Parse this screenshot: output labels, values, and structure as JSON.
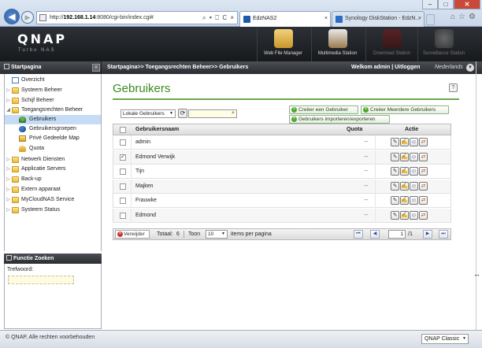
{
  "browser": {
    "address": {
      "prefix": "http://",
      "host": "192.168.1.14",
      "rest": ":8080/cgi-bin/index.cgi#"
    },
    "address_tools": "⌕ ▾ ⎕ C ×",
    "tabs": [
      {
        "label": "EdzNAS2",
        "active": true
      },
      {
        "label": "Synology DiskStation - EdzN...",
        "active": false
      }
    ],
    "window_controls": {
      "min": "–",
      "max": "□",
      "close": "✕"
    },
    "right_icons": "⌂☆⚙"
  },
  "qnap": {
    "logo": "QNAP",
    "subtitle": "Turbo NAS",
    "apps": [
      {
        "label": "Web File Manager"
      },
      {
        "label": "Multimedia Station"
      },
      {
        "label": "Download Station"
      },
      {
        "label": "Surveillance Station"
      }
    ]
  },
  "titlebar": {
    "side_title": "Startpagina",
    "collapse": "«",
    "breadcrumb": "Startpagina>> Toegangsrechten Beheer>> Gebruikers",
    "welcome": "Welkom admin | Uitloggen",
    "language": "Nederlands",
    "language_arrow": "▼"
  },
  "sidebar": {
    "items": [
      {
        "label": "Overzicht",
        "expander": ""
      },
      {
        "label": "Systeem Beheer",
        "expander": "▷"
      },
      {
        "label": "Schijf Beheer",
        "expander": "▷"
      },
      {
        "label": "Toegangsrechten Beheer",
        "expander": "◢"
      },
      {
        "label": "Gebruikers",
        "expander": ""
      },
      {
        "label": "Gebruikersgroepen",
        "expander": ""
      },
      {
        "label": "Privé Gedeelde Map",
        "expander": ""
      },
      {
        "label": "Quota",
        "expander": ""
      },
      {
        "label": "Netwerk Diensten",
        "expander": "▷"
      },
      {
        "label": "Applicatie Servers",
        "expander": "▷"
      },
      {
        "label": "Back-up",
        "expander": "▷"
      },
      {
        "label": "Extern apparaat",
        "expander": "▷"
      },
      {
        "label": "MyCloudNAS Service",
        "expander": "▷"
      },
      {
        "label": "Systeem Status",
        "expander": "▷"
      }
    ]
  },
  "func_search": {
    "title": "Functie Zoeken",
    "keyword_label": "Trefwoord:",
    "keyword_value": ""
  },
  "main": {
    "title": "Gebruikers",
    "help": "?",
    "buttons": {
      "create_user": "Creëer een Gebruiker",
      "create_multiple": "Creëer Meerdere Gebruikers",
      "import_export": "Gebruikers importeren/exporteren"
    },
    "filter_select": "Lokale Gebruikers",
    "refresh": "⟳",
    "search_value": "",
    "search_icon": "⌕",
    "columns": {
      "name": "Gebruikersnaam",
      "quota": "Quota",
      "action": "Actie"
    },
    "users": [
      {
        "name": "admin",
        "quota": "--",
        "checked": ""
      },
      {
        "name": "Edmond Verwijk",
        "quota": "--",
        "checked": "✓"
      },
      {
        "name": "Tijn",
        "quota": "--",
        "checked": ""
      },
      {
        "name": "Majken",
        "quota": "--",
        "checked": ""
      },
      {
        "name": "Frauwke",
        "quota": "--",
        "checked": ""
      },
      {
        "name": "Edmond",
        "quota": "--",
        "checked": ""
      }
    ],
    "action_icons": [
      "✎",
      "✍",
      "☺",
      "⇄"
    ],
    "pagination": {
      "delete": "Verwijder",
      "total_label": "Totaal:",
      "total_value": "6",
      "show_label": "Toon",
      "per_page_value": "10",
      "per_page_suffix": "items per pagina",
      "first": "⏮",
      "prev": "◀",
      "page_value": "1",
      "page_total": "/1",
      "next": "▶",
      "last": "⏭"
    }
  },
  "footer": {
    "copyright": "© QNAP, Alle rechten voorbehouden",
    "theme": "QNAP Classic"
  }
}
